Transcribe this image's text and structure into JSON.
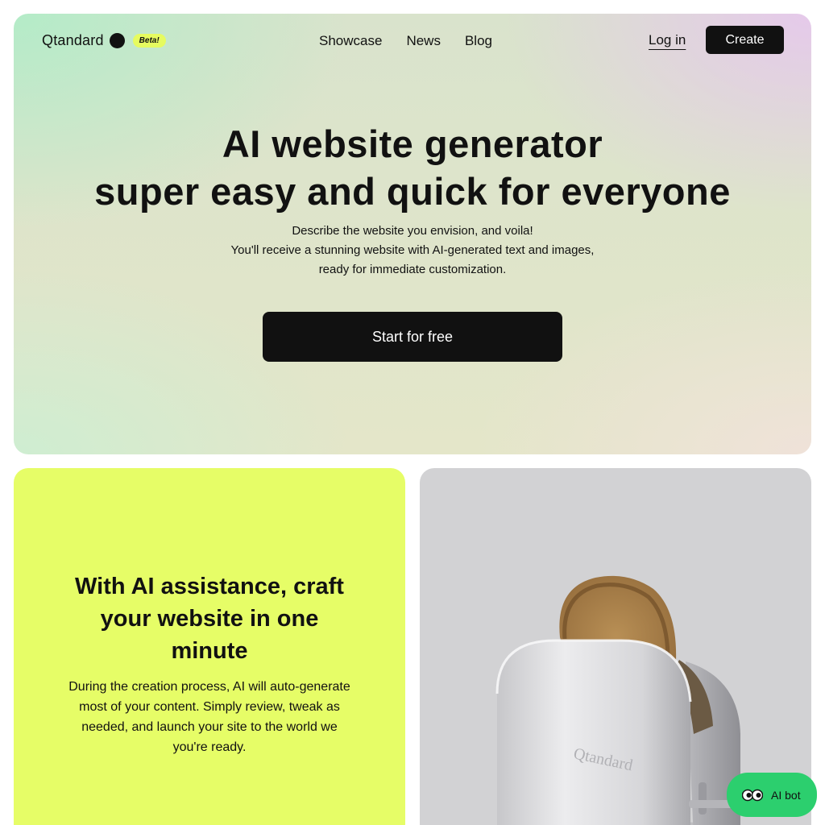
{
  "nav": {
    "brand_name": "Qtandard",
    "beta_label": "Beta!",
    "links": [
      "Showcase",
      "News",
      "Blog"
    ],
    "login_label": "Log in",
    "create_label": "Create"
  },
  "hero": {
    "title_line1": "AI website generator",
    "title_line2": "super easy and quick for everyone",
    "desc_line1": "Describe the website you envision, and voila!",
    "desc_line2": "You'll receive a stunning website with AI-generated text and images,",
    "desc_line3": "ready for immediate customization.",
    "cta_label": "Start for free"
  },
  "feature": {
    "title": "With AI assistance, craft your website in one minute",
    "description": "During the creation process, AI will auto-generate most of your content. Simply review, tweak as needed, and launch your site to the world we you're ready."
  },
  "image_card": {
    "toaster_brand": "Qtandard"
  },
  "ai_bot": {
    "label": "AI bot"
  },
  "colors": {
    "accent_dark": "#111111",
    "beta_badge": "#e6fb5f",
    "feature_card_bg": "#e6fd67",
    "image_card_bg": "#d2d2d4",
    "ai_bot_bg": "#2ccf6e"
  }
}
